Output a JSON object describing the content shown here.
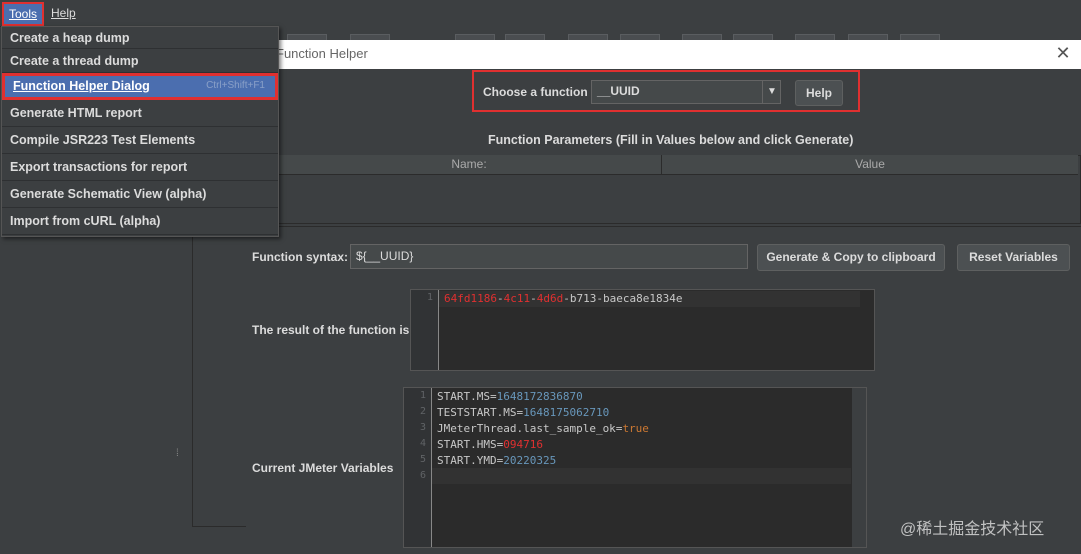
{
  "menubar": {
    "tools": "Tools",
    "help": "Help"
  },
  "tools_menu": {
    "items": [
      {
        "label": "Create a heap dump"
      },
      {
        "label": "Create a thread dump"
      },
      {
        "label": "Function Helper Dialog",
        "shortcut": "Ctrl+Shift+F1",
        "selected": true
      },
      {
        "label": "Generate HTML report"
      },
      {
        "label": "Compile JSR223 Test Elements"
      },
      {
        "label": "Export transactions for report"
      },
      {
        "label": "Generate Schematic View (alpha)"
      },
      {
        "label": "Import from cURL (alpha)"
      }
    ]
  },
  "dialog": {
    "title": "Function Helper",
    "close": "✕",
    "choose_label": "Choose a function",
    "function_value": "__UUID",
    "help_button": "Help",
    "params_title": "Function Parameters (Fill in Values below and click Generate)",
    "col_name": "Name:",
    "col_value": "Value",
    "syntax_label": "Function syntax:",
    "syntax_value": "${__UUID}",
    "generate_button": "Generate & Copy to clipboard",
    "reset_button": "Reset Variables",
    "result_label": "The result of the function is",
    "result": {
      "line": "1",
      "p1": "64fd1186",
      "d1": "-",
      "p2": "4c11",
      "d2": "-",
      "p3": "4d6d",
      "d3": "-",
      "p4": "b713-baeca8e1834e"
    },
    "vars_label": "Current JMeter Variables",
    "vars": [
      {
        "ln": "1",
        "key": "START.MS=",
        "val": "1648172836870",
        "color": "b"
      },
      {
        "ln": "2",
        "key": "TESTSTART.MS=",
        "val": "1648175062710",
        "color": "b"
      },
      {
        "ln": "3",
        "key": "JMeterThread.last_sample_ok=",
        "val": "true",
        "color": "o"
      },
      {
        "ln": "4",
        "key": "START.HMS=",
        "val": "094716",
        "color": "r"
      },
      {
        "ln": "5",
        "key": "START.YMD=",
        "val": "20220325",
        "color": "b"
      },
      {
        "ln": "6",
        "key": "",
        "val": "",
        "color": "b"
      }
    ]
  },
  "watermark": "@稀土掘金技术社区",
  "colors": {
    "accent": "#4b6eaf",
    "highlight_border": "#e03030",
    "background": "#3c3f41"
  }
}
